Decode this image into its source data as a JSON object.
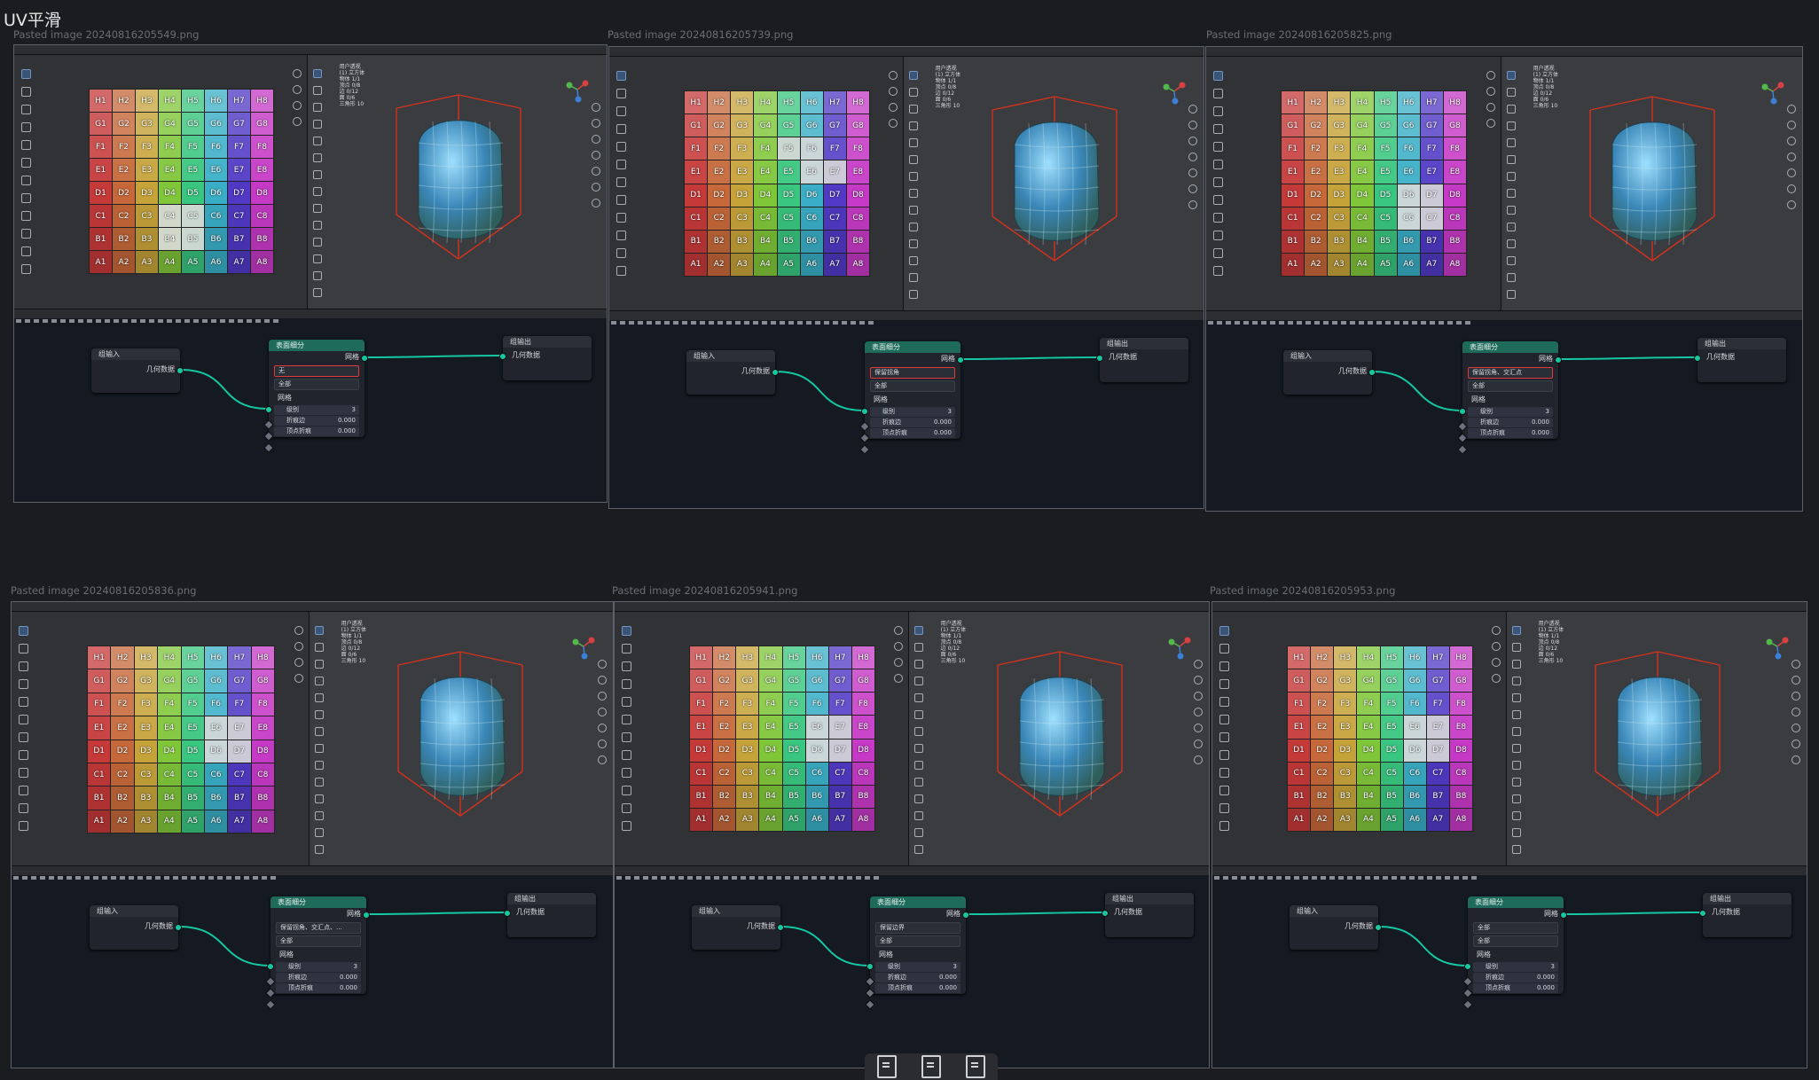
{
  "page": {
    "title": "UV平滑"
  },
  "colors": {
    "node_header": "#1e6b5c",
    "link": "#15c8a1",
    "highlight": "#e23a3a",
    "bounding_box": "#d2321e"
  },
  "uv_labels": [
    [
      "H1",
      "H2",
      "H3",
      "H4",
      "H5",
      "H6",
      "H7",
      "H8"
    ],
    [
      "G1",
      "G2",
      "G3",
      "G4",
      "G5",
      "G6",
      "G7",
      "G8"
    ],
    [
      "F1",
      "F2",
      "F3",
      "F4",
      "F5",
      "F6",
      "F7",
      "F8"
    ],
    [
      "E1",
      "E2",
      "E3",
      "E4",
      "E5",
      "E6",
      "E7",
      "E8"
    ],
    [
      "D1",
      "D2",
      "D3",
      "D4",
      "D5",
      "D6",
      "D7",
      "D8"
    ],
    [
      "C1",
      "C2",
      "C3",
      "C4",
      "C5",
      "C6",
      "C7",
      "C8"
    ],
    [
      "B1",
      "B2",
      "B3",
      "B4",
      "B5",
      "B6",
      "B7",
      "B8"
    ],
    [
      "A1",
      "A2",
      "A3",
      "A4",
      "A5",
      "A6",
      "A7",
      "A8"
    ]
  ],
  "uv_hues": [
    0,
    20,
    45,
    90,
    150,
    190,
    250,
    300
  ],
  "node_labels": {
    "group_input": "组输入",
    "group_output": "组输出",
    "geometry": "几何数据",
    "subdivide_title": "表面细分",
    "mesh": "网格",
    "level_label": "级别",
    "level_value": "3",
    "edge_crease_label": "折痕边",
    "edge_crease_value": "0.000",
    "vertex_crease_label": "顶点折痕",
    "vertex_crease_value": "0.000"
  },
  "stats": {
    "user_persp": "用户透视",
    "collection": "(1) 立方体",
    "lines": [
      "物体 1/1",
      "顶点 0/8",
      "边 0/12",
      "面 0/6",
      "三角形 10"
    ]
  },
  "shots": [
    {
      "caption": "Pasted image 20240816205549.png",
      "uv_mode": "无",
      "boundary": "全部",
      "mode_highlight": true,
      "selected": [
        [
          5,
          3
        ],
        [
          5,
          4
        ],
        [
          6,
          3
        ],
        [
          6,
          4
        ]
      ]
    },
    {
      "caption": "Pasted image 20240816205739.png",
      "uv_mode": "保留拐角",
      "boundary": "全部",
      "mode_highlight": true,
      "selected": [
        [
          2,
          4
        ],
        [
          2,
          5
        ],
        [
          3,
          5
        ],
        [
          3,
          6
        ]
      ]
    },
    {
      "caption": "Pasted image 20240816205825.png",
      "uv_mode": "保留拐角、交汇点",
      "boundary": "全部",
      "mode_highlight": true,
      "selected": [
        [
          4,
          5
        ],
        [
          4,
          6
        ],
        [
          5,
          5
        ],
        [
          5,
          6
        ]
      ]
    },
    {
      "caption": "Pasted image 20240816205836.png",
      "uv_mode": "保留拐角、交汇点、...",
      "boundary": "全部",
      "mode_highlight": false,
      "selected": [
        [
          3,
          5
        ],
        [
          3,
          6
        ],
        [
          4,
          5
        ],
        [
          4,
          6
        ]
      ]
    },
    {
      "caption": "Pasted image 20240816205941.png",
      "uv_mode": "保留边界",
      "boundary": "全部",
      "mode_highlight": false,
      "selected": [
        [
          3,
          5
        ],
        [
          3,
          6
        ],
        [
          4,
          5
        ],
        [
          4,
          6
        ]
      ]
    },
    {
      "caption": "Pasted image 20240816205953.png",
      "uv_mode": "全部",
      "boundary": "全部",
      "mode_highlight": false,
      "selected": [
        [
          3,
          5
        ],
        [
          3,
          6
        ],
        [
          4,
          5
        ],
        [
          4,
          6
        ]
      ]
    }
  ]
}
